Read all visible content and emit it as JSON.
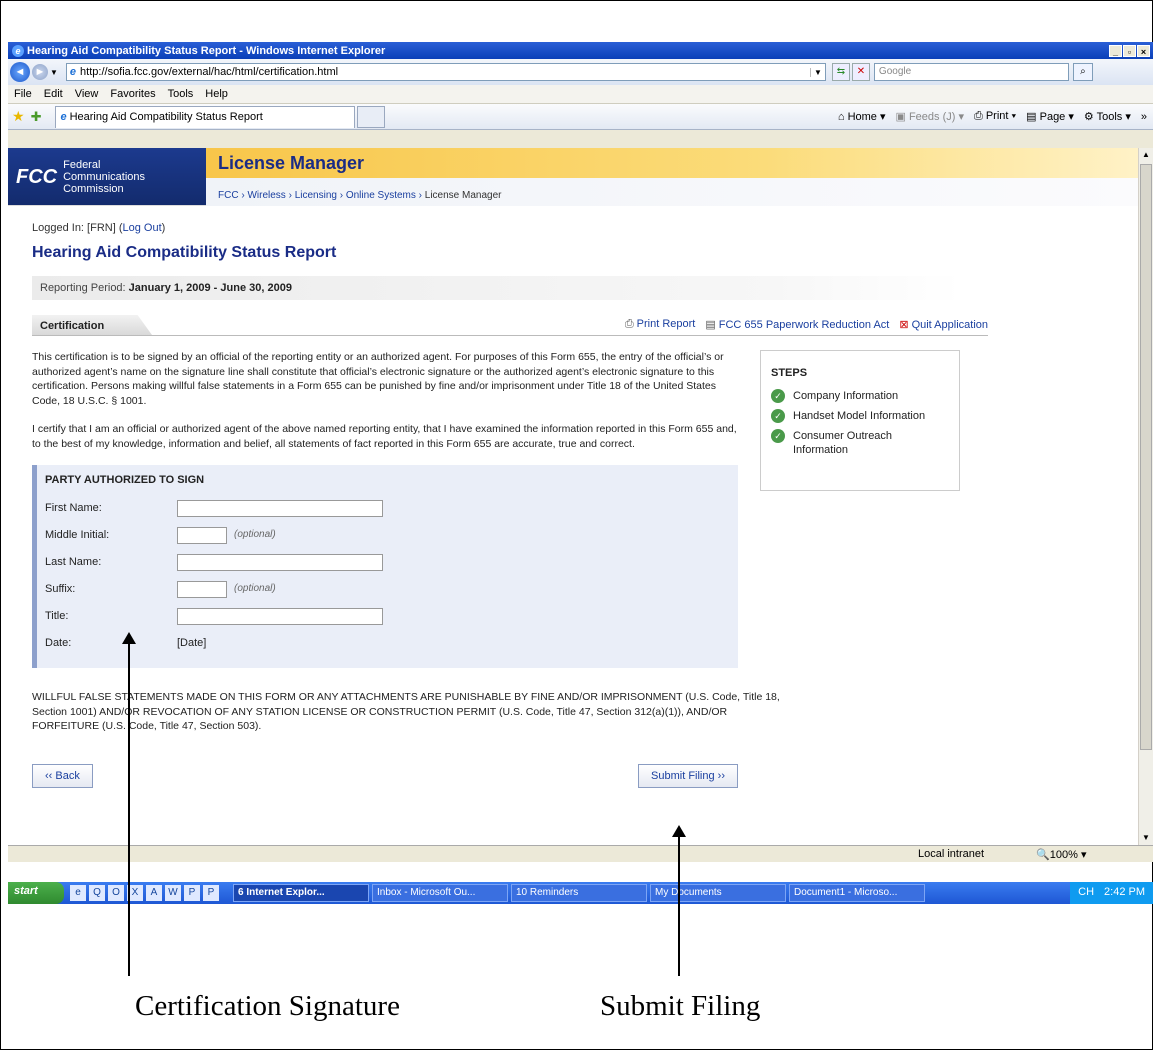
{
  "window": {
    "title": "Hearing Aid Compatibility Status Report - Windows Internet Explorer",
    "url": "http://sofia.fcc.gov/external/hac/html/certification.html",
    "search_placeholder": "Google"
  },
  "menu": [
    "File",
    "Edit",
    "View",
    "Favorites",
    "Tools",
    "Help"
  ],
  "browser_tab": "Hearing Aid Compatibility Status Report",
  "command_bar": {
    "home": "Home",
    "feeds": "Feeds (J)",
    "print": "Print",
    "page": "Page",
    "tools": "Tools"
  },
  "fcc": {
    "logo_mark": "FCC",
    "logo_lines": [
      "Federal",
      "Communications",
      "Commission"
    ],
    "app_title": "License Manager",
    "breadcrumb": [
      "FCC",
      "Wireless",
      "Licensing",
      "Online Systems",
      "License Manager"
    ]
  },
  "page": {
    "logged_in": "Logged In: [FRN]",
    "logout": "Log Out",
    "heading": "Hearing Aid Compatibility Status Report",
    "period_label": "Reporting Period:",
    "period_value": "January 1, 2009 - June 30, 2009",
    "section_tab": "Certification",
    "links": {
      "print": "Print Report",
      "paperwork": "FCC 655 Paperwork Reduction Act",
      "quit": "Quit Application"
    },
    "para1": "This certification is to be signed by an official of the reporting entity or an authorized agent. For purposes of this Form 655, the entry of the official’s or authorized agent’s name on the signature line shall constitute that official’s electronic signature or the authorized agent’s electronic signature to this certification. Persons making willful false statements in a Form 655 can be punished by fine and/or imprisonment under Title 18 of the United States Code, 18 U.S.C. § 1001.",
    "para2": "I certify that I am an official or authorized agent of the above named reporting entity, that I have examined the information reported in this Form 655 and, to the best of my knowledge, information and belief, all statements of fact reported in this Form 655 are accurate, true and correct.",
    "steps_title": "STEPS",
    "steps": [
      "Company Information",
      "Handset Model Information",
      "Consumer Outreach Information"
    ],
    "form": {
      "title": "PARTY AUTHORIZED TO SIGN",
      "first_name": "First Name:",
      "middle_initial": "Middle Initial:",
      "last_name": "Last Name:",
      "suffix": "Suffix:",
      "title_label": "Title:",
      "date_label": "Date:",
      "date_value": "[Date]",
      "optional": "(optional)"
    },
    "warning": "WILLFUL FALSE STATEMENTS MADE ON THIS FORM OR ANY ATTACHMENTS ARE PUNISHABLE BY FINE AND/OR IMPRISONMENT (U.S. Code, Title 18, Section 1001) AND/OR REVOCATION OF ANY STATION LICENSE OR CONSTRUCTION PERMIT (U.S. Code, Title 47, Section 312(a)(1)), AND/OR FORFEITURE (U.S. Code, Title 47, Section 503).",
    "back": "‹‹ Back",
    "submit": "Submit Filing ››"
  },
  "status": {
    "zone": "Local intranet",
    "zoom": "100%"
  },
  "taskbar": {
    "start": "start",
    "tasks": [
      "6 Internet Explor...",
      "Inbox - Microsoft Ou...",
      "10 Reminders",
      "My Documents",
      "Document1 - Microso..."
    ],
    "clock": "2:42 PM",
    "lang": "CH"
  },
  "annotations": {
    "left": "Certification Signature",
    "right": "Submit Filing"
  }
}
